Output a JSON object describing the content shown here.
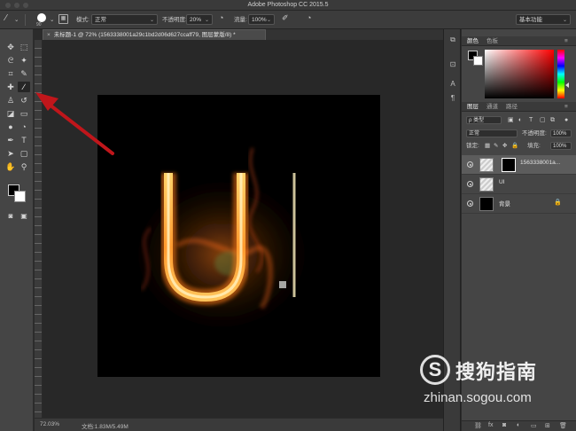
{
  "app": {
    "window_title": "Adobe Photoshop CC 2015.5"
  },
  "options_bar": {
    "brush_size": "90",
    "mode_label": "模式:",
    "mode_value": "正常",
    "opacity_label": "不透明度:",
    "opacity_value": "20%",
    "flow_label": "流量:",
    "flow_value": "100%",
    "workspace_value": "基本功能"
  },
  "document": {
    "tab_title": "未标题-1 @ 72% (1563338001a29c1bd2d06d627ccaff79, 图层蒙版/8) *",
    "tab_close": "×",
    "artwork_text": "UI"
  },
  "status_bar": {
    "zoom": "72.03%",
    "doc_size": "文档:1.83M/5.49M"
  },
  "tools": [
    {
      "name": "move-tool-icon",
      "glyph": "✥"
    },
    {
      "name": "marquee-tool-icon",
      "glyph": "⬚"
    },
    {
      "name": "lasso-tool-icon",
      "glyph": "ᘓ"
    },
    {
      "name": "magic-wand-tool-icon",
      "glyph": "✦"
    },
    {
      "name": "crop-tool-icon",
      "glyph": "⌗"
    },
    {
      "name": "eyedropper-tool-icon",
      "glyph": "✎"
    },
    {
      "name": "healing-brush-tool-icon",
      "glyph": "✚"
    },
    {
      "name": "brush-tool-icon",
      "glyph": "∕"
    },
    {
      "name": "clone-stamp-tool-icon",
      "glyph": "♙"
    },
    {
      "name": "history-brush-tool-icon",
      "glyph": "↺"
    },
    {
      "name": "eraser-tool-icon",
      "glyph": "◪"
    },
    {
      "name": "gradient-tool-icon",
      "glyph": "▭"
    },
    {
      "name": "blur-tool-icon",
      "glyph": "●"
    },
    {
      "name": "dodge-tool-icon",
      "glyph": "◔"
    },
    {
      "name": "pen-tool-icon",
      "glyph": "✒"
    },
    {
      "name": "type-tool-icon",
      "glyph": "T"
    },
    {
      "name": "path-selection-tool-icon",
      "glyph": "➤"
    },
    {
      "name": "shape-tool-icon",
      "glyph": "▢"
    },
    {
      "name": "hand-tool-icon",
      "glyph": "✋"
    },
    {
      "name": "zoom-tool-icon",
      "glyph": "⚲"
    }
  ],
  "color_panel": {
    "tabs": [
      "颜色",
      "色板"
    ]
  },
  "layers_panel": {
    "tabs": [
      "图层",
      "通道",
      "路径"
    ],
    "filter_label": "ρ 类型",
    "blend_mode": "正常",
    "opacity_label": "不透明度:",
    "opacity_value": "100%",
    "lock_label": "锁定:",
    "fill_label": "填充:",
    "fill_value": "100%",
    "layers": [
      {
        "name": "1563338001a...",
        "selected": true
      },
      {
        "name": "UI",
        "selected": false
      },
      {
        "name": "背景",
        "selected": false
      }
    ],
    "footer_icons": [
      "link-icon",
      "fx-icon",
      "mask-icon",
      "adjustment-icon",
      "folder-icon",
      "new-layer-icon",
      "trash-icon"
    ]
  },
  "watermark": {
    "logo_letter": "S",
    "name": "搜狗指南",
    "url": "zhinan.sogou.com"
  },
  "colors": {
    "accent_arrow": "#c0161b",
    "fire_orange": "#ff8c1a",
    "fire_core": "#ffe38a"
  }
}
